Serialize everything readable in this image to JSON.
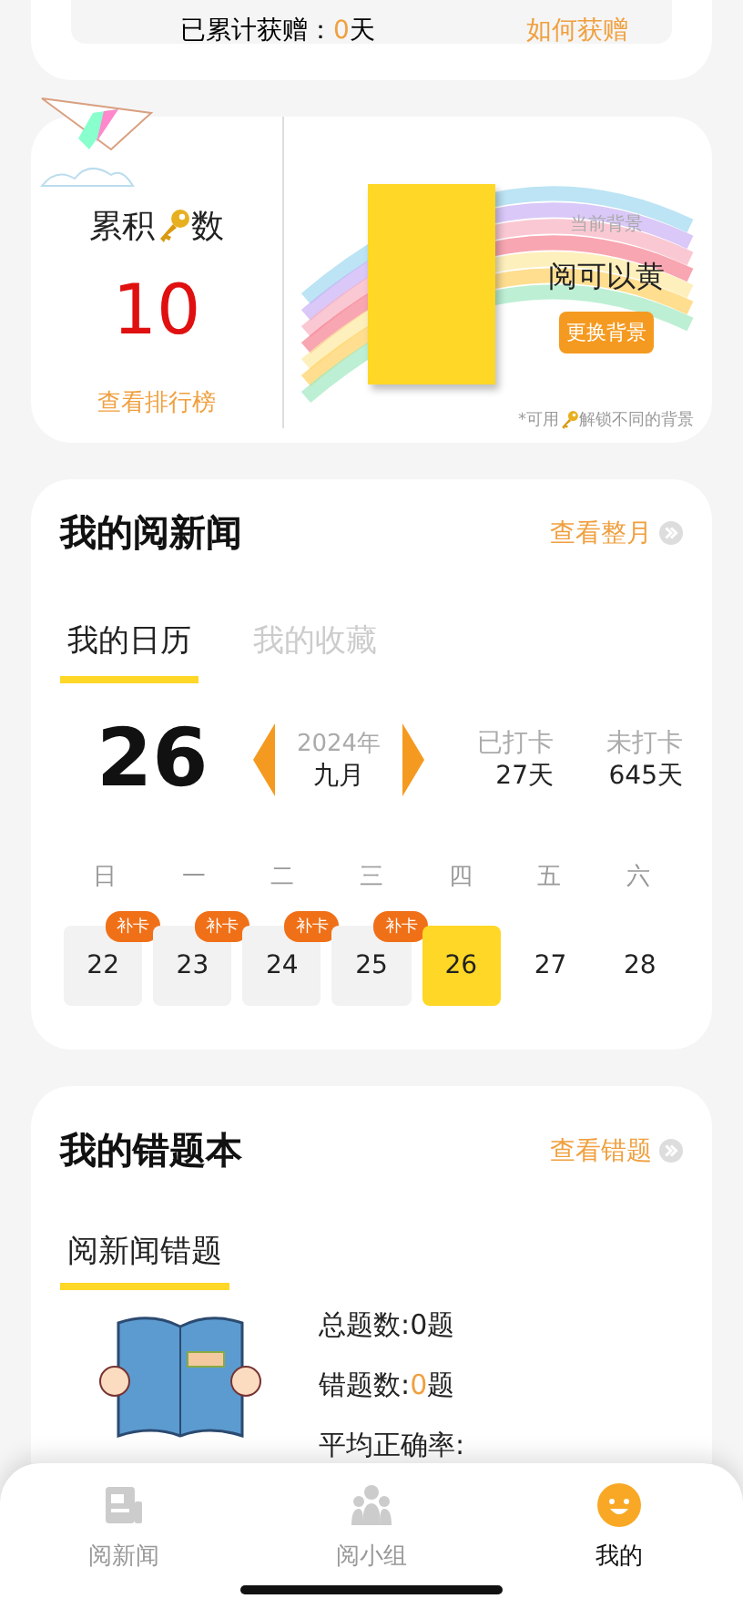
{
  "gift_card": {
    "prefix": "已累计获赠：",
    "days": "0",
    "suffix": "天",
    "link": "如何获赠"
  },
  "keys_card": {
    "title_before": "累积",
    "title_after": "数",
    "count": "10",
    "link": "查看排行榜",
    "background_caption": "当前背景",
    "background_name": "阅可以黄",
    "change_button": "更换背景",
    "note_before": "*可用",
    "note_after": "解锁不同的背景"
  },
  "news_card": {
    "title": "我的阅新闻",
    "link": "查看整月",
    "tabs": [
      {
        "label": "我的日历",
        "selected": true
      },
      {
        "label": "我的收藏",
        "selected": false
      }
    ],
    "day": "26",
    "year": "2024年",
    "month": "九月",
    "signed_label": "已打卡",
    "signed_value": "27天",
    "unsigned_label": "未打卡",
    "unsigned_value": "645天",
    "weekdays": [
      "日",
      "一",
      "二",
      "三",
      "四",
      "五",
      "六"
    ],
    "days": [
      {
        "date": "22",
        "kind": "missed",
        "badge": "补卡",
        "selected": false
      },
      {
        "date": "23",
        "kind": "missed",
        "badge": "补卡",
        "selected": false
      },
      {
        "date": "24",
        "kind": "missed",
        "badge": "补卡",
        "selected": false
      },
      {
        "date": "25",
        "kind": "missed",
        "badge": "补卡",
        "selected": false
      },
      {
        "date": "26",
        "kind": "plain",
        "selected": true
      },
      {
        "date": "27",
        "kind": "plain",
        "selected": false
      },
      {
        "date": "28",
        "kind": "plain",
        "selected": false
      }
    ]
  },
  "mistakes_card": {
    "title": "我的错题本",
    "link": "查看错题",
    "tab": {
      "label": "阅新闻错题",
      "selected": true
    },
    "stats": [
      {
        "label": "总题数:",
        "value": "0",
        "unit": "题",
        "highlight": false
      },
      {
        "label": "错题数:",
        "value": "0",
        "unit": "题",
        "highlight": true
      },
      {
        "label": "平均正确率:"
      }
    ]
  },
  "tab_bar": [
    {
      "label": "阅新闻",
      "kind": "news",
      "selected": false
    },
    {
      "label": "阅小组",
      "kind": "group",
      "selected": false
    },
    {
      "label": "我的",
      "kind": "me",
      "selected": true
    }
  ]
}
